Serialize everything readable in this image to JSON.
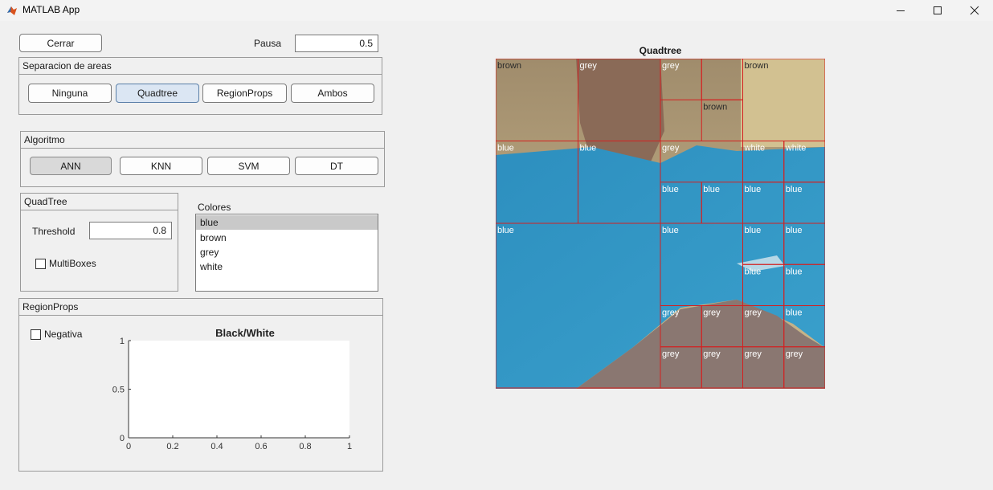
{
  "window": {
    "title": "MATLAB App",
    "controls": [
      "minimize-icon",
      "maximize-icon",
      "close-icon"
    ]
  },
  "top": {
    "close_label": "Cerrar",
    "pause_label": "Pausa",
    "pause_value": "0.5"
  },
  "areas": {
    "title": "Separacion de areas",
    "buttons": [
      "Ninguna",
      "Quadtree",
      "RegionProps",
      "Ambos"
    ],
    "selected": "Quadtree"
  },
  "algoritmo": {
    "title": "Algoritmo",
    "buttons": [
      "ANN",
      "KNN",
      "SVM",
      "DT"
    ],
    "selected": "ANN"
  },
  "quadtree_panel": {
    "title": "QuadTree",
    "threshold_label": "Threshold",
    "threshold_value": "0.8",
    "multiboxes_label": "MultiBoxes",
    "multiboxes_checked": false
  },
  "colores": {
    "label": "Colores",
    "items": [
      "blue",
      "brown",
      "grey",
      "white"
    ],
    "selected": "blue"
  },
  "regionprops": {
    "title": "RegionProps",
    "negativa_label": "Negativa",
    "negativa_checked": false
  },
  "bw_plot": {
    "title": "Black/White",
    "x_ticks": [
      "0",
      "0.2",
      "0.4",
      "0.6",
      "0.8",
      "1"
    ],
    "y_ticks": [
      "0",
      "0.5",
      "1"
    ]
  },
  "quadtree_image": {
    "title": "Quadtree",
    "cells": [
      {
        "label": "brown",
        "color": "brown"
      },
      {
        "label": "grey",
        "color": "grey"
      },
      {
        "label": "grey",
        "color": "grey"
      },
      {
        "label": "brown",
        "color": "brown"
      },
      {
        "label": "brown",
        "color": "brown"
      },
      {
        "label": "blue",
        "color": "blue"
      },
      {
        "label": "blue",
        "color": "blue"
      },
      {
        "label": "grey",
        "color": "grey"
      },
      {
        "label": "white",
        "color": "white"
      },
      {
        "label": "white",
        "color": "white"
      },
      {
        "label": "blue",
        "color": "blue"
      },
      {
        "label": "blue",
        "color": "blue"
      },
      {
        "label": "blue",
        "color": "blue"
      },
      {
        "label": "blue",
        "color": "blue"
      },
      {
        "label": "blue",
        "color": "blue"
      },
      {
        "label": "blue",
        "color": "blue"
      },
      {
        "label": "blue",
        "color": "blue"
      },
      {
        "label": "blue",
        "color": "blue"
      },
      {
        "label": "blue",
        "color": "blue"
      },
      {
        "label": "blue",
        "color": "blue"
      },
      {
        "label": "grey",
        "color": "grey"
      },
      {
        "label": "grey",
        "color": "grey"
      },
      {
        "label": "grey",
        "color": "grey"
      },
      {
        "label": "blue",
        "color": "blue"
      },
      {
        "label": "grey",
        "color": "grey"
      },
      {
        "label": "grey",
        "color": "grey"
      },
      {
        "label": "grey",
        "color": "grey"
      },
      {
        "label": "grey",
        "color": "grey"
      }
    ]
  }
}
